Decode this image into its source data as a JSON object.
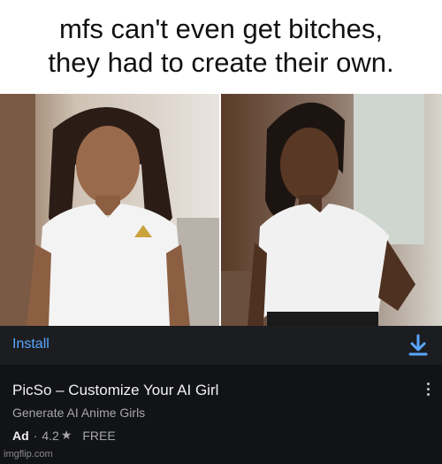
{
  "caption": {
    "line1": "mfs can't even get bitches,",
    "line2": "they had to create their own."
  },
  "photos": [
    {
      "description_icon": "portrait-photo-1"
    },
    {
      "description_icon": "portrait-photo-2"
    }
  ],
  "ad": {
    "install_label": "Install",
    "download_icon": "download-icon",
    "title": "PicSo – Customize Your AI Girl",
    "subtitle": "Generate AI Anime Girls",
    "badge": "Ad",
    "separator": "·",
    "rating": "4.2",
    "star": "★",
    "price": "FREE",
    "more_icon": "more-vertical-icon"
  },
  "watermark": "imgflip.com",
  "colors": {
    "install_blue": "#5aa6ff",
    "ad_bg": "#121316",
    "install_bar_bg": "#1c1d21"
  }
}
